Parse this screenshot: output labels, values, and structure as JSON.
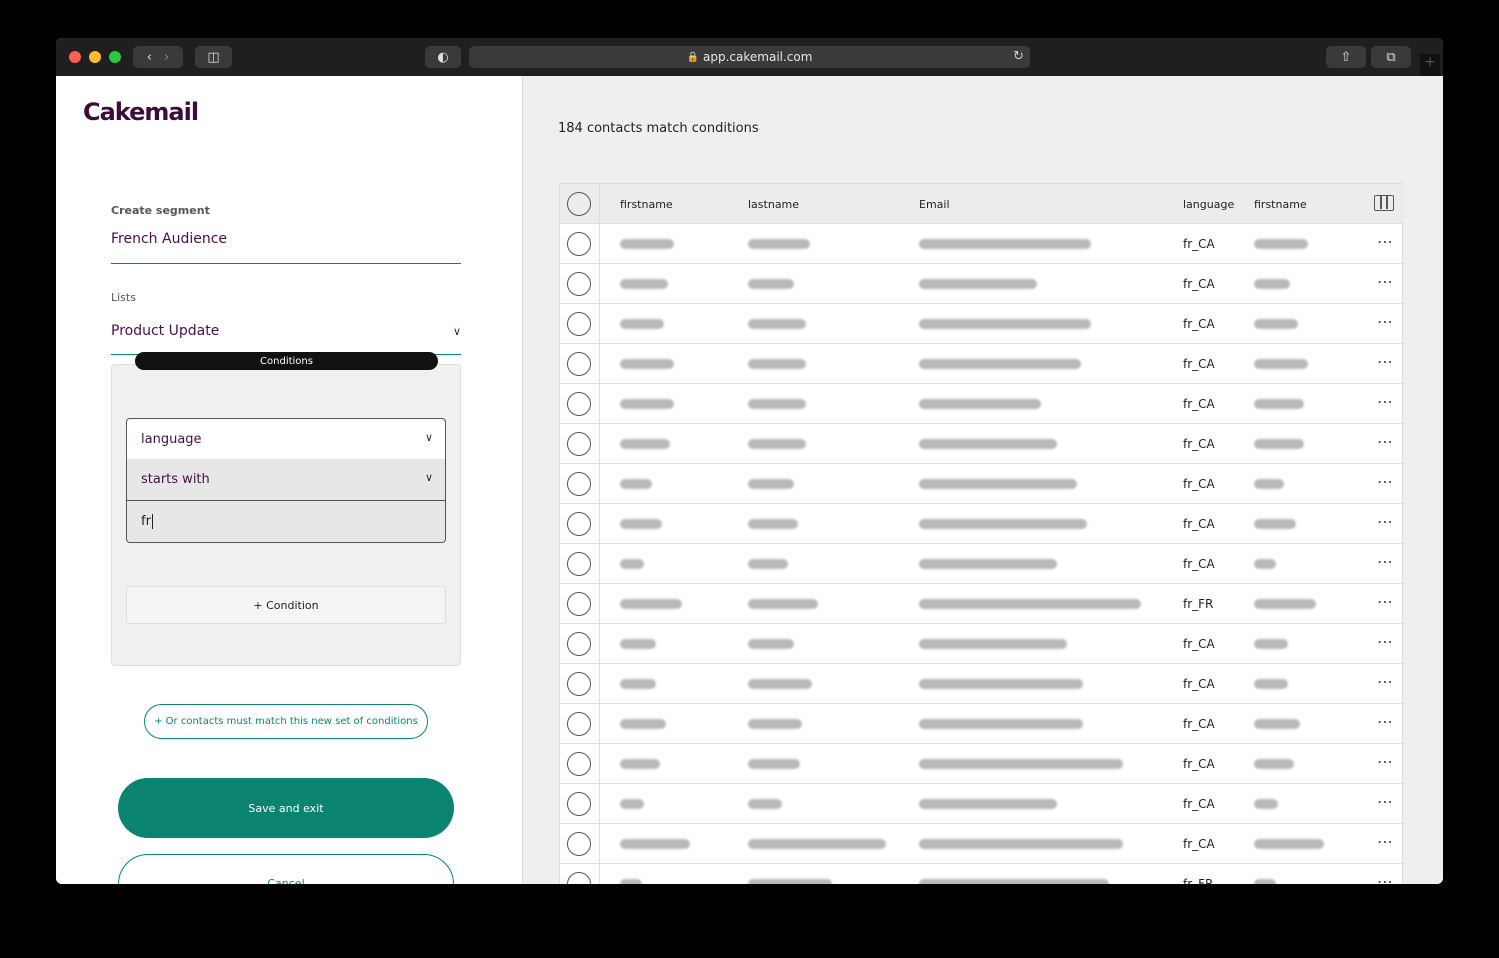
{
  "browser": {
    "url": "app.cakemail.com"
  },
  "sidebar": {
    "logo": "Cakemail",
    "create_segment_label": "Create segment",
    "segment_name": "French Audience",
    "lists_label": "Lists",
    "list_value": "Product Update",
    "conditions_label": "Conditions",
    "condition": {
      "field": "language",
      "operator": "starts with",
      "value": "fr"
    },
    "add_condition_label": "+ Condition",
    "or_button_label": "+ Or contacts must match this new set of conditions",
    "save_label": "Save and exit",
    "cancel_label": "Cancel"
  },
  "results": {
    "summary": "184 contacts match conditions",
    "columns": [
      "firstname",
      "lastname",
      "Email",
      "language",
      "firstname"
    ],
    "rows": [
      {
        "language": "fr_CA"
      },
      {
        "language": "fr_CA"
      },
      {
        "language": "fr_CA"
      },
      {
        "language": "fr_CA"
      },
      {
        "language": "fr_CA"
      },
      {
        "language": "fr_CA"
      },
      {
        "language": "fr_CA"
      },
      {
        "language": "fr_CA"
      },
      {
        "language": "fr_CA"
      },
      {
        "language": "fr_FR"
      },
      {
        "language": "fr_CA"
      },
      {
        "language": "fr_CA"
      },
      {
        "language": "fr_CA"
      },
      {
        "language": "fr_CA"
      },
      {
        "language": "fr_CA"
      },
      {
        "language": "fr_CA"
      },
      {
        "language": "fr_FR"
      }
    ]
  },
  "colors": {
    "brand": "#3a0d3a",
    "accent": "#0a8470"
  }
}
